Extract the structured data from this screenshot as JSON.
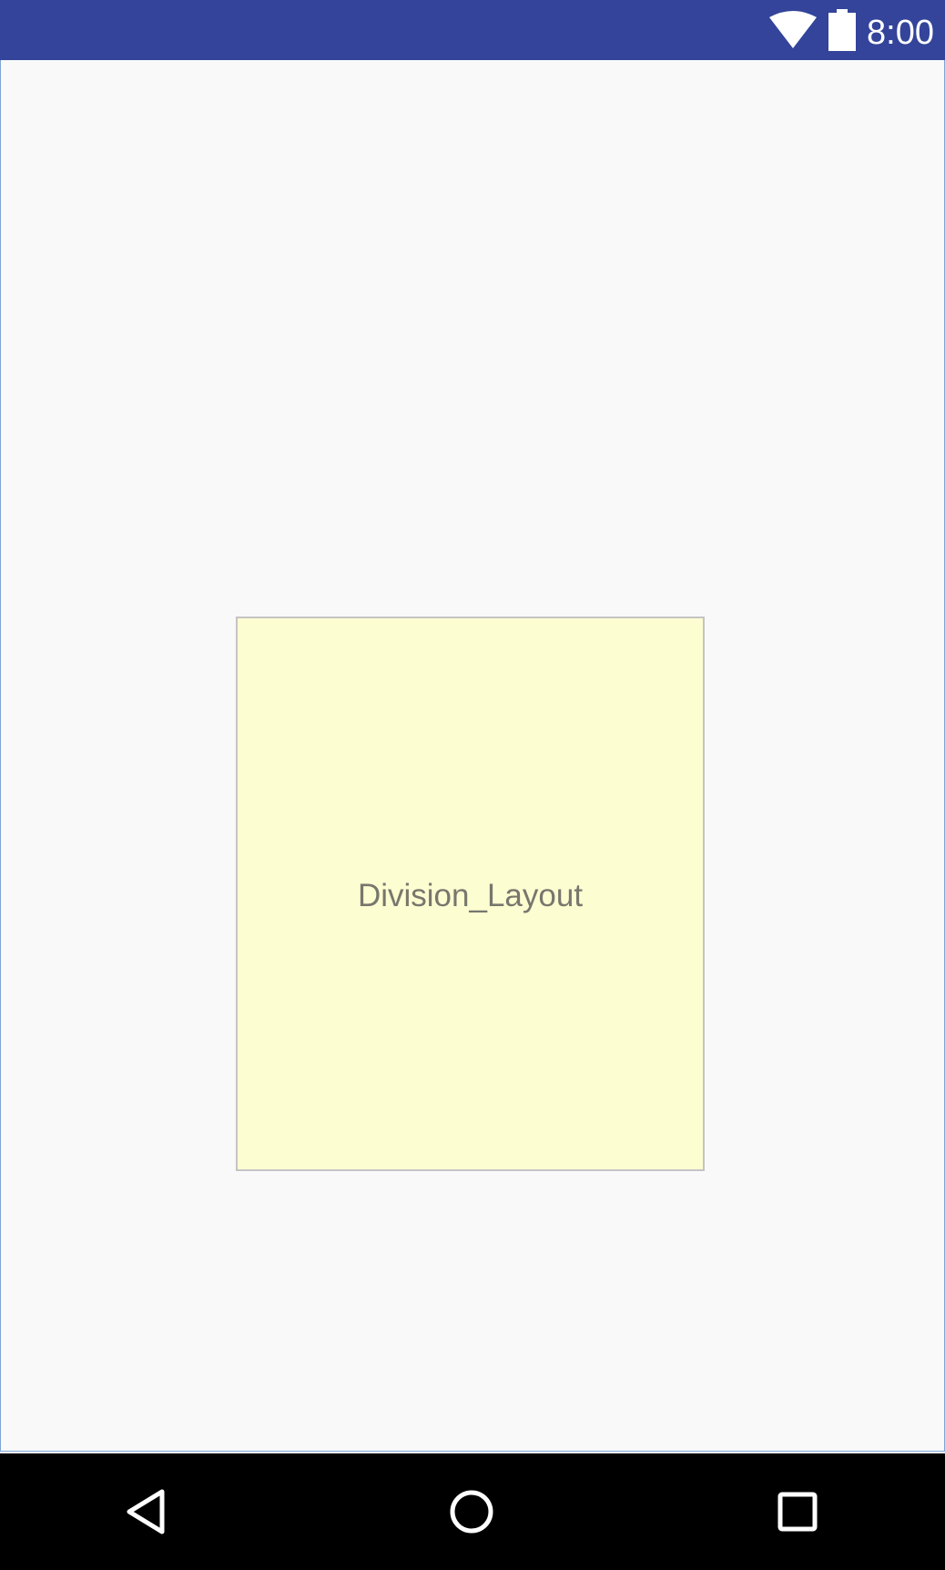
{
  "status_bar": {
    "time": "8:00",
    "icons": [
      "wifi-icon",
      "battery-icon"
    ],
    "background_color": "#33449a"
  },
  "content": {
    "division_layout": {
      "label": "Division_Layout",
      "background_color": "#fdfdd2"
    }
  },
  "nav_bar": {
    "buttons": [
      "back-icon",
      "home-icon",
      "recents-icon"
    ]
  }
}
